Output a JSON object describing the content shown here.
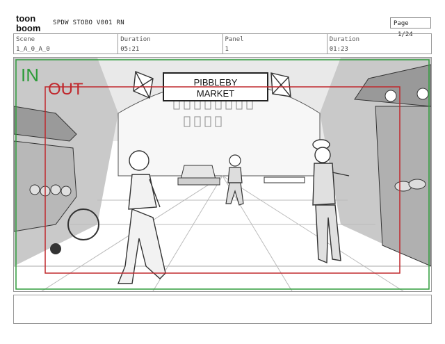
{
  "header": {
    "logo_top": "toon",
    "logo_bottom": "boom",
    "doc_title": "SPDW STOBO  V001 RN",
    "page_label": "Page",
    "page_value": "1/24"
  },
  "meta": {
    "scene_label": "Scene",
    "scene_value": "1_A_0_A_0",
    "duration_label": "Duration",
    "duration_value": "05:21",
    "panel_label": "Panel",
    "panel_value": "1",
    "panel_duration_label": "Duration",
    "panel_duration_value": "01:23"
  },
  "panel": {
    "in_label": "IN",
    "out_label": "OUT",
    "sign_line1": "PIBBLEBY",
    "sign_line2": "MARKET"
  },
  "colors": {
    "in_frame": "#2e9c3a",
    "out_frame": "#c0282d"
  },
  "notes": {
    "text": ""
  }
}
